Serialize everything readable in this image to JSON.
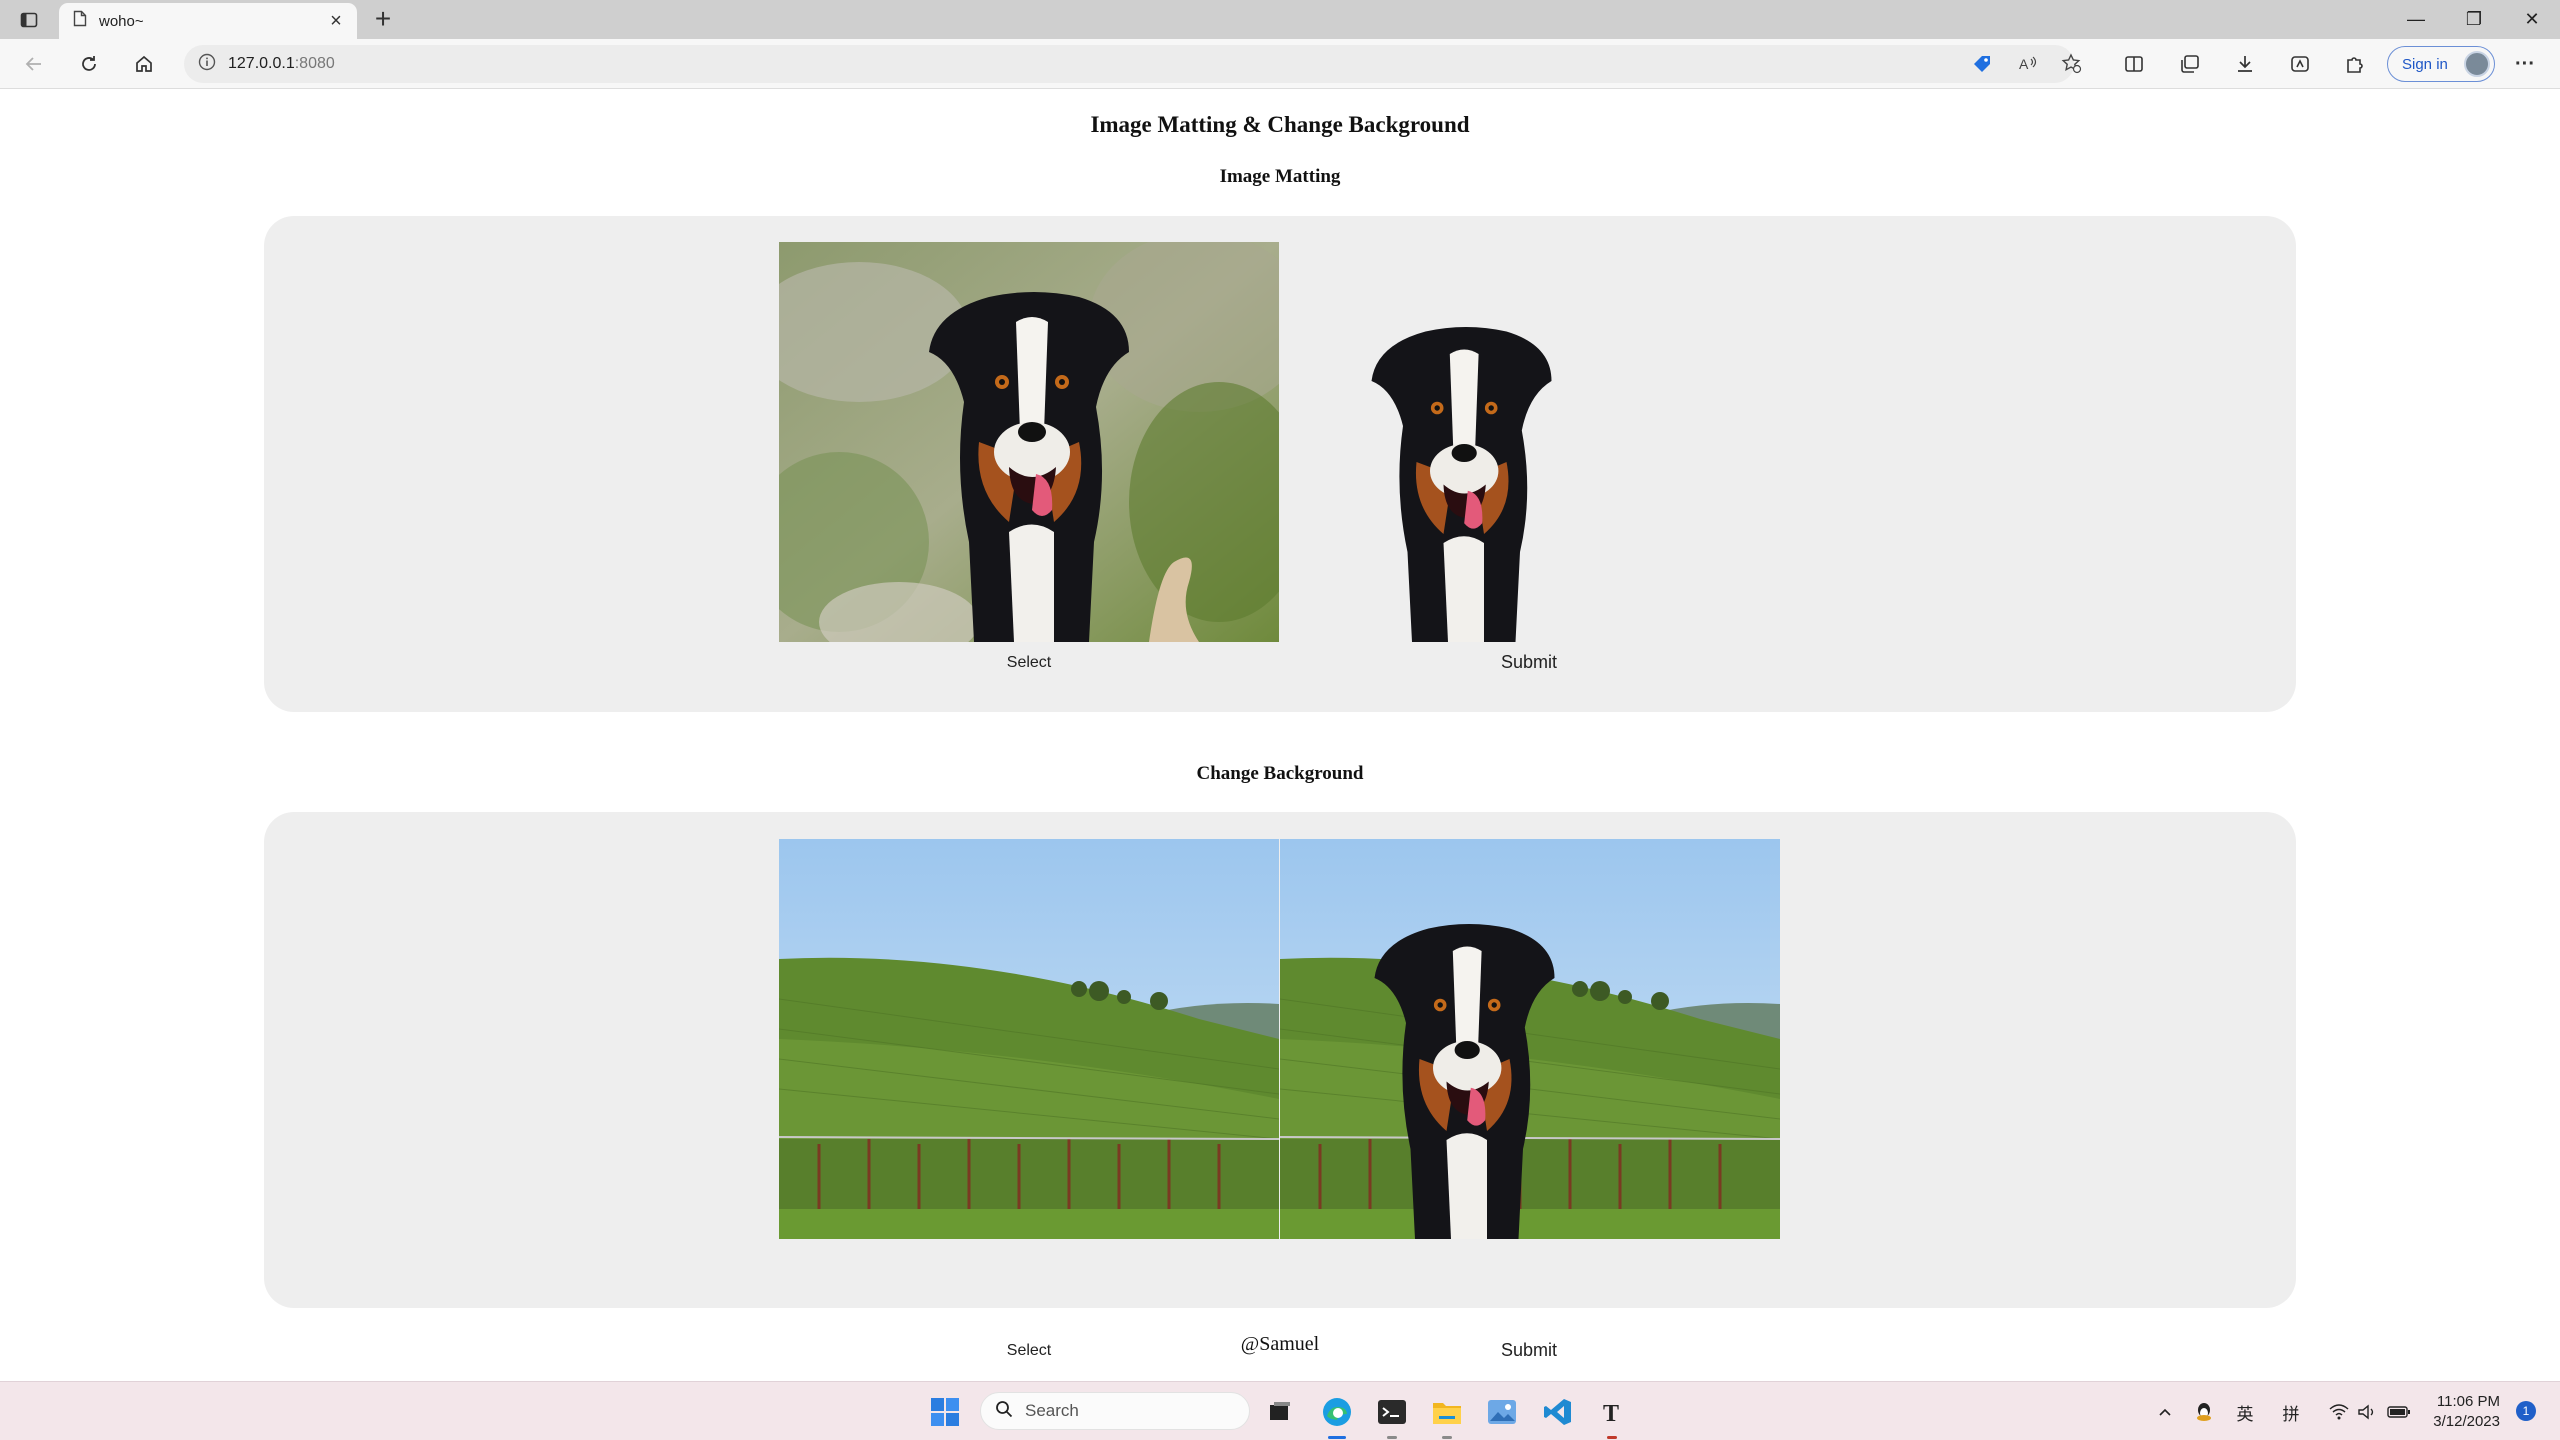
{
  "browser": {
    "tab_title": "woho~",
    "tab_close": "×",
    "new_tab": "+",
    "address_host": "127.0.0.1",
    "address_port": ":8080",
    "sign_in_label": "Sign in",
    "win_minimize": "—",
    "win_restore": "❐",
    "win_close": "✕",
    "more_label": "···"
  },
  "page": {
    "title": "Image Matting & Change Background",
    "matting_section": {
      "heading": "Image Matting",
      "select_label": "Select",
      "submit_label": "Submit"
    },
    "background_section": {
      "heading": "Change Background",
      "select_label": "Select",
      "submit_label": "Submit"
    },
    "footer_credit": "@Samuel"
  },
  "taskbar": {
    "search_label": "Search",
    "tray_lang": "英",
    "tray_ime": "拼",
    "clock_time": "11:06 PM",
    "clock_date": "3/12/2023",
    "notification_count": "1"
  },
  "colors": {
    "panel_bg": "#eeeeee",
    "taskbar_bg": "#f3e6ea",
    "accent_blue": "#1f57c6"
  }
}
